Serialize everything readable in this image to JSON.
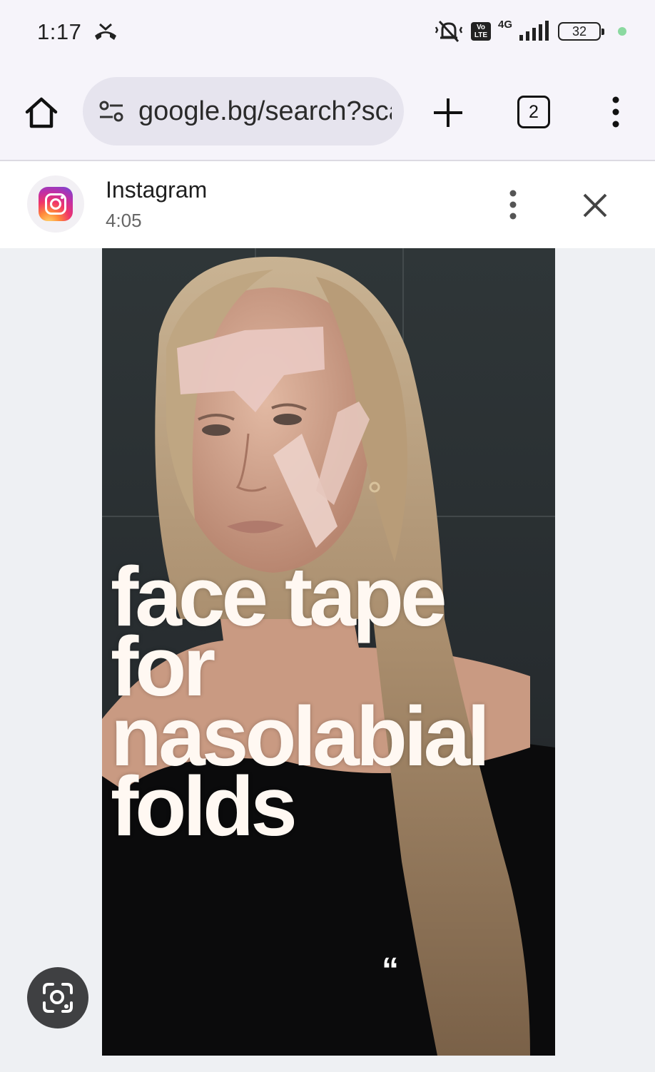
{
  "status_bar": {
    "time": "1:17",
    "battery": "32",
    "network": "4G",
    "volte": "Vo LTE"
  },
  "browser": {
    "url": "google.bg/search?sca_esv",
    "tab_count": "2"
  },
  "source": {
    "title": "Instagram",
    "duration": "4:05"
  },
  "image": {
    "caption_lines": [
      "face tape",
      "for",
      "nasolabial",
      "folds"
    ],
    "quote": "“"
  },
  "colors": {
    "accent_green": "#8bd9a0",
    "omnibox_bg": "#e6e4ee",
    "lens_button_bg": "#3f4042"
  }
}
